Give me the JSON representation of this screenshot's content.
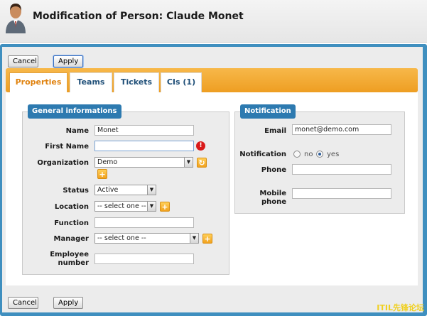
{
  "header": {
    "title": "Modification of Person: Claude Monet",
    "icon": "person-icon"
  },
  "buttons": {
    "cancel": "Cancel",
    "apply": "Apply"
  },
  "tabs": [
    {
      "label": "Properties",
      "active": true
    },
    {
      "label": "Teams",
      "active": false
    },
    {
      "label": "Tickets",
      "active": false
    },
    {
      "label": "CIs (1)",
      "active": false
    }
  ],
  "general": {
    "legend": "General informations",
    "name_label": "Name",
    "name_value": "Monet",
    "first_name_label": "First Name",
    "first_name_value": "",
    "organization_label": "Organization",
    "organization_value": "Demo",
    "status_label": "Status",
    "status_value": "Active",
    "location_label": "Location",
    "location_value": "-- select one --",
    "function_label": "Function",
    "function_value": "",
    "manager_label": "Manager",
    "manager_value": "-- select one --",
    "employee_number_label": "Employee number",
    "employee_number_value": ""
  },
  "notification": {
    "legend": "Notification",
    "email_label": "Email",
    "email_value": "monet@demo.com",
    "notification_label": "Notification",
    "option_no": "no",
    "option_yes": "yes",
    "selected": "yes",
    "phone_label": "Phone",
    "phone_value": "",
    "mobile_phone_label": "Mobile phone",
    "mobile_phone_value": ""
  },
  "watermark": "ITIL先锋论坛",
  "colors": {
    "frame": "#3f8fbf",
    "tabbar": "#f0a22a",
    "legend": "#2d7ab0",
    "active_tab": "#e0820e"
  }
}
